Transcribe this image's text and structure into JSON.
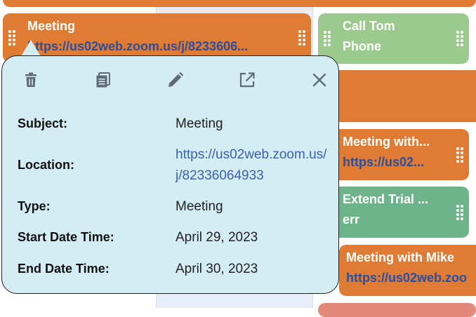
{
  "calendar": {
    "events": [
      {
        "id": "meeting-left",
        "title": "Meeting",
        "subtitle": "https://us02web.zoom.us/j/8233606...",
        "color": "#df7b33"
      },
      {
        "id": "call-tom",
        "title": "Call Tom",
        "subtitle": "Phone",
        "color": "#9cc98d"
      },
      {
        "id": "meeting-with-1",
        "title": "Meeting with...",
        "subtitle": "https://us02...",
        "color": "#df7b33"
      },
      {
        "id": "extend-trial",
        "title": "Extend Trial ...",
        "subtitle": "err",
        "color": "#6db48a"
      },
      {
        "id": "meeting-with-mike",
        "title": "Meeting with Mike",
        "subtitle": "https://us02web.zoo",
        "color": "#df7b33"
      }
    ]
  },
  "popup": {
    "toolbar": {
      "delete_icon": "trash-icon",
      "copy_icon": "copy-icon",
      "edit_icon": "pencil-icon",
      "open_icon": "external-link-icon",
      "close_icon": "close-icon"
    },
    "fields": {
      "subject_label": "Subject:",
      "subject_value": "Meeting",
      "location_label": "Location:",
      "location_line1": "https://us02web.zoom.us/",
      "location_line2": "j/82336064933",
      "type_label": "Type:",
      "type_value": "Meeting",
      "start_label": "Start Date Time:",
      "start_value": "April 29, 2023",
      "end_label": "End Date Time:",
      "end_value": "April 30, 2023"
    }
  }
}
